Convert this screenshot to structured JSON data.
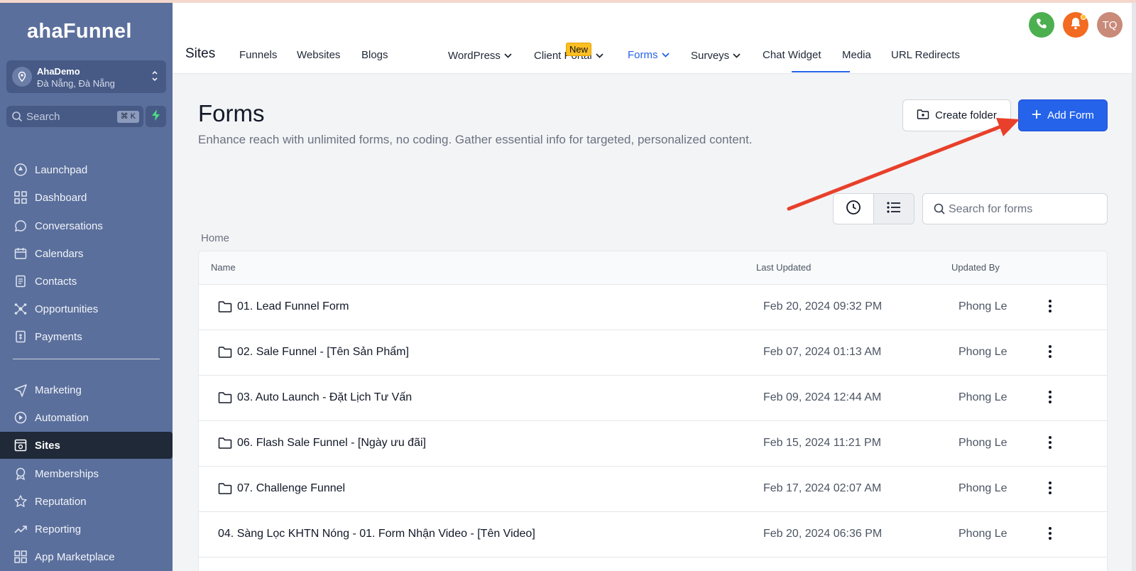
{
  "brand": {
    "logo": "ahaFunnel"
  },
  "account": {
    "name": "AhaDemo",
    "location": "Đà Nẵng, Đà Nẵng"
  },
  "sidebar_search": {
    "placeholder": "Search",
    "shortcut": "⌘ K"
  },
  "sidebar": {
    "items": [
      {
        "label": "Launchpad",
        "icon": "rocket-icon"
      },
      {
        "label": "Dashboard",
        "icon": "grid-icon"
      },
      {
        "label": "Conversations",
        "icon": "chat-icon"
      },
      {
        "label": "Calendars",
        "icon": "calendar-icon"
      },
      {
        "label": "Contacts",
        "icon": "address-book-icon"
      },
      {
        "label": "Opportunities",
        "icon": "network-icon"
      },
      {
        "label": "Payments",
        "icon": "receipt-icon"
      },
      {
        "label": "Marketing",
        "icon": "send-icon"
      },
      {
        "label": "Automation",
        "icon": "automation-icon"
      },
      {
        "label": "Sites",
        "icon": "sites-icon",
        "active": true
      },
      {
        "label": "Memberships",
        "icon": "badge-icon"
      },
      {
        "label": "Reputation",
        "icon": "star-icon"
      },
      {
        "label": "Reporting",
        "icon": "trend-icon"
      },
      {
        "label": "App Marketplace",
        "icon": "apps-icon"
      }
    ]
  },
  "header": {
    "title": "Sites",
    "tabs": [
      {
        "label": "Funnels"
      },
      {
        "label": "Websites"
      },
      {
        "label": "Blogs",
        "badge": "New"
      },
      {
        "label": "WordPress",
        "dropdown": true
      },
      {
        "label": "Client Portal",
        "dropdown": true
      },
      {
        "label": "Forms",
        "dropdown": true,
        "active": true
      },
      {
        "label": "Surveys",
        "dropdown": true
      },
      {
        "label": "Chat Widget"
      },
      {
        "label": "Media"
      },
      {
        "label": "URL Redirects"
      }
    ],
    "user_initials": "TQ",
    "colors": {
      "phone": "#4caf50",
      "bell": "#f26b21",
      "avatar": "#c98a7a"
    }
  },
  "main": {
    "title": "Forms",
    "description": "Enhance reach with unlimited forms, no coding. Gather essential info for targeted, personalized content.",
    "create_folder_label": "Create folder",
    "add_form_label": "Add Form",
    "search_placeholder": "Search for forms",
    "breadcrumb": "Home",
    "columns": {
      "name": "Name",
      "last_updated": "Last Updated",
      "updated_by": "Updated By"
    },
    "rows": [
      {
        "name": "01. Lead Funnel Form",
        "last_updated": "Feb 20, 2024 09:32 PM",
        "updated_by": "Phong Le",
        "folder": true
      },
      {
        "name": "02. Sale Funnel - [Tên Sản Phẩm]",
        "last_updated": "Feb 07, 2024 01:13 AM",
        "updated_by": "Phong Le",
        "folder": true
      },
      {
        "name": "03. Auto Launch - Đặt Lịch Tư Vấn",
        "last_updated": "Feb 09, 2024 12:44 AM",
        "updated_by": "Phong Le",
        "folder": true
      },
      {
        "name": "06. Flash Sale Funnel - [Ngày ưu đãi]",
        "last_updated": "Feb 15, 2024 11:21 PM",
        "updated_by": "Phong Le",
        "folder": true
      },
      {
        "name": "07. Challenge Funnel",
        "last_updated": "Feb 17, 2024 02:07 AM",
        "updated_by": "Phong Le",
        "folder": true
      },
      {
        "name": "04. Sàng Lọc KHTN Nóng - 01. Form Nhận Video - [Tên Video]",
        "last_updated": "Feb 20, 2024 06:36 PM",
        "updated_by": "Phong Le",
        "folder": false
      }
    ]
  }
}
